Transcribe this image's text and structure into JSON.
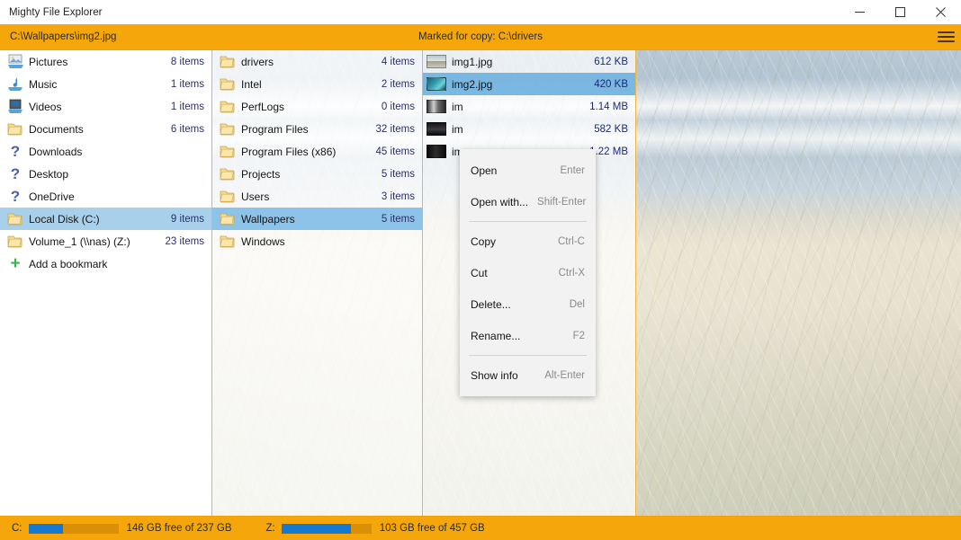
{
  "window": {
    "title": "Mighty File Explorer",
    "controls": [
      {
        "name": "minimize-button",
        "glyph": "minimize"
      },
      {
        "name": "maximize-button",
        "glyph": "maximize"
      },
      {
        "name": "close-button",
        "glyph": "close"
      }
    ]
  },
  "pathbar": {
    "path": "C:\\Wallpapers\\img2.jpg",
    "status": "Marked for copy: C:\\drivers",
    "menu_icon": "hamburger-menu-icon",
    "background": "#f5a60b"
  },
  "sidebar": {
    "items": [
      {
        "label": "Pictures",
        "count": "8 items",
        "icon": "pictures-icon",
        "selected": false
      },
      {
        "label": "Music",
        "count": "1 items",
        "icon": "music-icon",
        "selected": false
      },
      {
        "label": "Videos",
        "count": "1 items",
        "icon": "videos-icon",
        "selected": false
      },
      {
        "label": "Documents",
        "count": "6 items",
        "icon": "folder-icon",
        "selected": false
      },
      {
        "label": "Downloads",
        "count": "",
        "icon": "unknown-icon",
        "selected": false
      },
      {
        "label": "Desktop",
        "count": "",
        "icon": "unknown-icon",
        "selected": false
      },
      {
        "label": "OneDrive",
        "count": "",
        "icon": "unknown-icon",
        "selected": false
      },
      {
        "label": "Local Disk (C:)",
        "count": "9 items",
        "icon": "folder-icon",
        "selected": true
      },
      {
        "label": "Volume_1 (\\\\nas) (Z:)",
        "count": "23 items",
        "icon": "folder-icon",
        "selected": false
      },
      {
        "label": "Add a bookmark",
        "count": "",
        "icon": "plus-icon",
        "selected": false
      }
    ]
  },
  "folders": {
    "items": [
      {
        "label": "drivers",
        "count": "4 items",
        "icon": "folder-icon",
        "selected": false
      },
      {
        "label": "Intel",
        "count": "2 items",
        "icon": "folder-icon",
        "selected": false
      },
      {
        "label": "PerfLogs",
        "count": "0 items",
        "icon": "folder-icon",
        "selected": false
      },
      {
        "label": "Program Files",
        "count": "32 items",
        "icon": "folder-icon",
        "selected": false
      },
      {
        "label": "Program Files (x86)",
        "count": "45 items",
        "icon": "folder-icon",
        "selected": false
      },
      {
        "label": "Projects",
        "count": "5 items",
        "icon": "folder-icon",
        "selected": false
      },
      {
        "label": "Users",
        "count": "3 items",
        "icon": "folder-icon",
        "selected": false
      },
      {
        "label": "Wallpapers",
        "count": "5 items",
        "icon": "folder-icon",
        "selected": true
      },
      {
        "label": "Windows",
        "count": "",
        "icon": "folder-icon",
        "selected": false
      }
    ]
  },
  "files": {
    "items": [
      {
        "label": "img1.jpg",
        "size": "612 KB",
        "thumb": "t1",
        "selected": false
      },
      {
        "label": "img2.jpg",
        "size": "420 KB",
        "thumb": "t2",
        "selected": true
      },
      {
        "label": "im",
        "size": "1.14 MB",
        "thumb": "t3",
        "selected": false
      },
      {
        "label": "im",
        "size": "582 KB",
        "thumb": "t4",
        "selected": false
      },
      {
        "label": "im",
        "size": "1.22 MB",
        "thumb": "t5",
        "selected": false
      }
    ]
  },
  "context_menu": {
    "items": [
      {
        "label": "Open",
        "accel": "Enter",
        "separator_after": false
      },
      {
        "label": "Open with...",
        "accel": "Shift-Enter",
        "separator_after": true
      },
      {
        "label": "Copy",
        "accel": "Ctrl-C",
        "separator_after": false
      },
      {
        "label": "Cut",
        "accel": "Ctrl-X",
        "separator_after": false
      },
      {
        "label": "Delete...",
        "accel": "Del",
        "separator_after": false
      },
      {
        "label": "Rename...",
        "accel": "F2",
        "separator_after": true
      },
      {
        "label": "Show info",
        "accel": "Alt-Enter",
        "separator_after": false
      }
    ]
  },
  "statusbar": {
    "drives": [
      {
        "label": "C:",
        "text": "146 GB free of 237 GB",
        "used_percent": 38
      },
      {
        "label": "Z:",
        "text": "103 GB free of 457 GB",
        "used_percent": 77
      }
    ],
    "fill_color": "#1778d0"
  }
}
